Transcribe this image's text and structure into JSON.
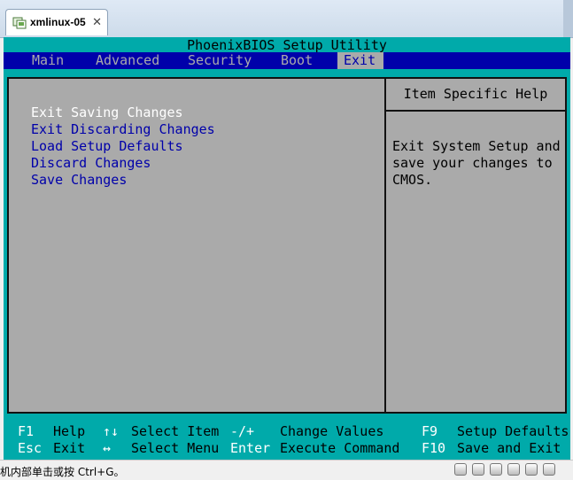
{
  "window": {
    "tab_label": "xmlinux-05",
    "tab_icon": "vm-icon",
    "close_glyph": "✕"
  },
  "bios": {
    "title": "PhoenixBIOS Setup Utility",
    "menu": [
      {
        "label": "Main"
      },
      {
        "label": "Advanced"
      },
      {
        "label": "Security"
      },
      {
        "label": "Boot"
      },
      {
        "label": "Exit",
        "active": true
      }
    ],
    "options": [
      {
        "label": "Exit Saving Changes",
        "selected": true
      },
      {
        "label": "Exit Discarding Changes"
      },
      {
        "label": "Load Setup Defaults"
      },
      {
        "label": "Discard Changes"
      },
      {
        "label": "Save Changes"
      }
    ],
    "help": {
      "title": "Item Specific Help",
      "lines": [
        "Exit System Setup and",
        "save your changes to",
        "CMOS."
      ]
    },
    "footer": {
      "row1": [
        {
          "key": "F1",
          "desc": "Help"
        },
        {
          "key": "↑↓",
          "desc": "Select Item"
        },
        {
          "key": "-/+",
          "desc": "Change Values"
        },
        {
          "key": "F9",
          "desc": "Setup Defaults"
        }
      ],
      "row2": [
        {
          "key": "Esc",
          "desc": "Exit"
        },
        {
          "key": "↔",
          "desc": "Select Menu"
        },
        {
          "key": "Enter",
          "desc": "Execute Command"
        },
        {
          "key": "F10",
          "desc": "Save and Exit"
        }
      ]
    },
    "colors": {
      "background": "#00aaaa",
      "menubar": "#0000aa",
      "panel": "#aaaaaa",
      "selected_text": "#ffffff"
    }
  },
  "statusbar": {
    "hint": "机内部单击或按 Ctrl+G。"
  }
}
